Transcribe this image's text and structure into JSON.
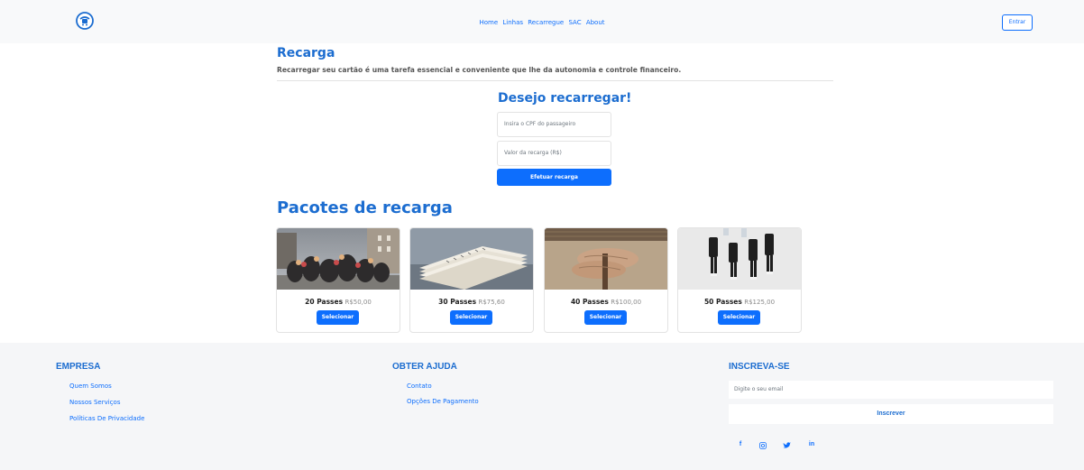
{
  "header": {
    "nav": [
      "Home",
      "Linhas",
      "Recarregue",
      "SAC",
      "About"
    ],
    "login_label": "Entrar"
  },
  "intro": {
    "title": "Recarga",
    "description": "Recarregar seu cartão é uma tarefa essencial e conveniente que lhe da autonomia e controle financeiro."
  },
  "form": {
    "title": "Desejo recarregar!",
    "cpf_placeholder": "Insira o CPF do passageiro",
    "valor_placeholder": "Valor da recarga (R$)",
    "submit_label": "Efetuar recarga"
  },
  "packages": {
    "title": "Pacotes de recarga",
    "select_label": "Selecionar",
    "items": [
      {
        "passes": "20 Passes",
        "price": "R$50,00"
      },
      {
        "passes": "30 Passes",
        "price": "R$75,60"
      },
      {
        "passes": "40 Passes",
        "price": "R$100,00"
      },
      {
        "passes": "50 Passes",
        "price": "R$125,00"
      }
    ]
  },
  "footer": {
    "empresa": {
      "title": "EMPRESA",
      "links": [
        "Quem Somos",
        "Nossos Serviços",
        "Políticas De Privacidade"
      ]
    },
    "ajuda": {
      "title": "OBTER AJUDA",
      "links": [
        "Contato",
        "Opções De Pagamento"
      ]
    },
    "inscreva": {
      "title": "INSCREVA-SE",
      "email_placeholder": "Digite o seu email",
      "button_label": "Inscrever"
    },
    "social_icons": [
      "facebook-icon",
      "instagram-icon",
      "twitter-icon",
      "linkedin-icon"
    ]
  },
  "colors": {
    "primary": "#0d6efd",
    "heading": "#1c6dd0",
    "header_bg": "#f8f9fa",
    "footer_bg": "#f5f6f8"
  }
}
